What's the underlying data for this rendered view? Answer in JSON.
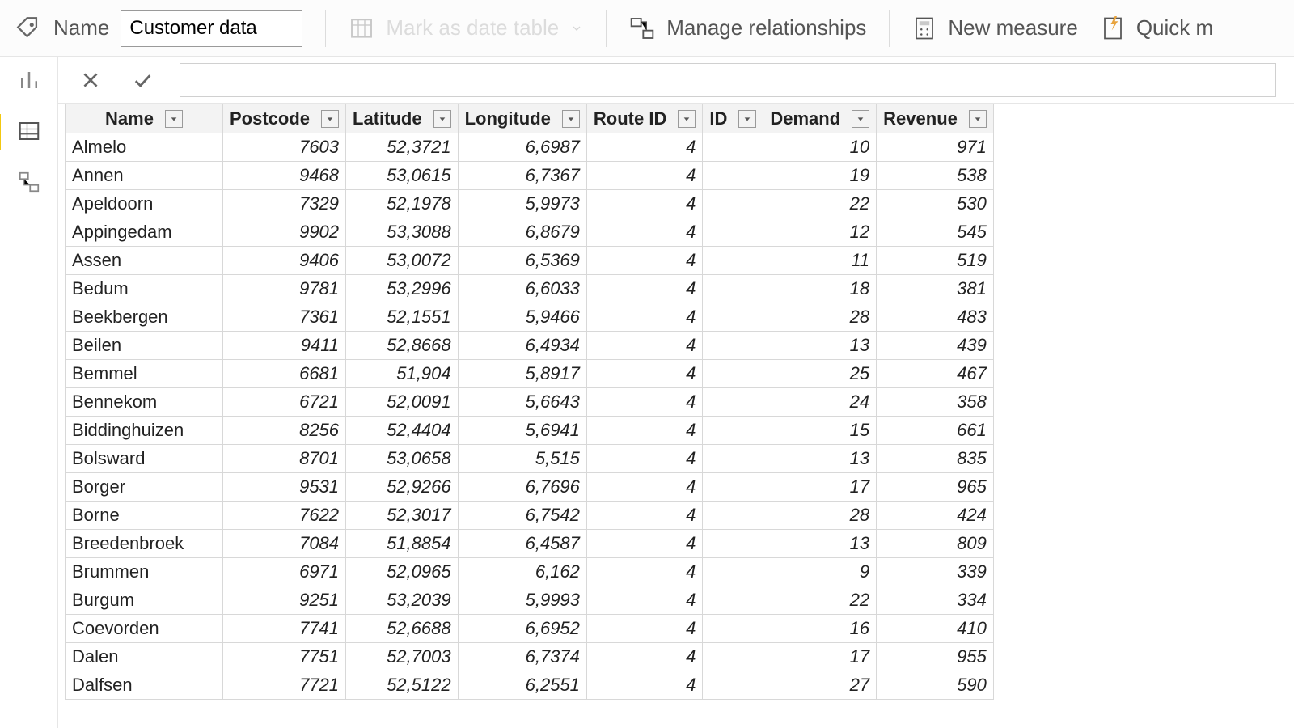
{
  "ribbon": {
    "name_label": "Name",
    "name_value": "Customer data",
    "mark_date": "Mark as date table",
    "manage_rel": "Manage relationships",
    "new_measure": "New measure",
    "quick": "Quick m"
  },
  "columns": [
    {
      "key": "name",
      "label": "Name",
      "type": "txt"
    },
    {
      "key": "postcode",
      "label": "Postcode",
      "type": "num"
    },
    {
      "key": "lat",
      "label": "Latitude",
      "type": "num"
    },
    {
      "key": "long",
      "label": "Longitude",
      "type": "num"
    },
    {
      "key": "route",
      "label": "Route ID",
      "type": "num"
    },
    {
      "key": "id",
      "label": "ID",
      "type": "num"
    },
    {
      "key": "demand",
      "label": "Demand",
      "type": "num"
    },
    {
      "key": "revenue",
      "label": "Revenue",
      "type": "num"
    }
  ],
  "rows": [
    {
      "name": "Almelo",
      "postcode": "7603",
      "lat": "52,3721",
      "long": "6,6987",
      "route": "4",
      "id": "",
      "demand": "10",
      "revenue": "971"
    },
    {
      "name": "Annen",
      "postcode": "9468",
      "lat": "53,0615",
      "long": "6,7367",
      "route": "4",
      "id": "",
      "demand": "19",
      "revenue": "538"
    },
    {
      "name": "Apeldoorn",
      "postcode": "7329",
      "lat": "52,1978",
      "long": "5,9973",
      "route": "4",
      "id": "",
      "demand": "22",
      "revenue": "530"
    },
    {
      "name": "Appingedam",
      "postcode": "9902",
      "lat": "53,3088",
      "long": "6,8679",
      "route": "4",
      "id": "",
      "demand": "12",
      "revenue": "545"
    },
    {
      "name": "Assen",
      "postcode": "9406",
      "lat": "53,0072",
      "long": "6,5369",
      "route": "4",
      "id": "",
      "demand": "11",
      "revenue": "519"
    },
    {
      "name": "Bedum",
      "postcode": "9781",
      "lat": "53,2996",
      "long": "6,6033",
      "route": "4",
      "id": "",
      "demand": "18",
      "revenue": "381"
    },
    {
      "name": "Beekbergen",
      "postcode": "7361",
      "lat": "52,1551",
      "long": "5,9466",
      "route": "4",
      "id": "",
      "demand": "28",
      "revenue": "483"
    },
    {
      "name": "Beilen",
      "postcode": "9411",
      "lat": "52,8668",
      "long": "6,4934",
      "route": "4",
      "id": "",
      "demand": "13",
      "revenue": "439"
    },
    {
      "name": "Bemmel",
      "postcode": "6681",
      "lat": "51,904",
      "long": "5,8917",
      "route": "4",
      "id": "",
      "demand": "25",
      "revenue": "467"
    },
    {
      "name": "Bennekom",
      "postcode": "6721",
      "lat": "52,0091",
      "long": "5,6643",
      "route": "4",
      "id": "",
      "demand": "24",
      "revenue": "358"
    },
    {
      "name": "Biddinghuizen",
      "postcode": "8256",
      "lat": "52,4404",
      "long": "5,6941",
      "route": "4",
      "id": "",
      "demand": "15",
      "revenue": "661"
    },
    {
      "name": "Bolsward",
      "postcode": "8701",
      "lat": "53,0658",
      "long": "5,515",
      "route": "4",
      "id": "",
      "demand": "13",
      "revenue": "835"
    },
    {
      "name": "Borger",
      "postcode": "9531",
      "lat": "52,9266",
      "long": "6,7696",
      "route": "4",
      "id": "",
      "demand": "17",
      "revenue": "965"
    },
    {
      "name": "Borne",
      "postcode": "7622",
      "lat": "52,3017",
      "long": "6,7542",
      "route": "4",
      "id": "",
      "demand": "28",
      "revenue": "424"
    },
    {
      "name": "Breedenbroek",
      "postcode": "7084",
      "lat": "51,8854",
      "long": "6,4587",
      "route": "4",
      "id": "",
      "demand": "13",
      "revenue": "809"
    },
    {
      "name": "Brummen",
      "postcode": "6971",
      "lat": "52,0965",
      "long": "6,162",
      "route": "4",
      "id": "",
      "demand": "9",
      "revenue": "339"
    },
    {
      "name": "Burgum",
      "postcode": "9251",
      "lat": "53,2039",
      "long": "5,9993",
      "route": "4",
      "id": "",
      "demand": "22",
      "revenue": "334"
    },
    {
      "name": "Coevorden",
      "postcode": "7741",
      "lat": "52,6688",
      "long": "6,6952",
      "route": "4",
      "id": "",
      "demand": "16",
      "revenue": "410"
    },
    {
      "name": "Dalen",
      "postcode": "7751",
      "lat": "52,7003",
      "long": "6,7374",
      "route": "4",
      "id": "",
      "demand": "17",
      "revenue": "955"
    },
    {
      "name": "Dalfsen",
      "postcode": "7721",
      "lat": "52,5122",
      "long": "6,2551",
      "route": "4",
      "id": "",
      "demand": "27",
      "revenue": "590"
    }
  ]
}
